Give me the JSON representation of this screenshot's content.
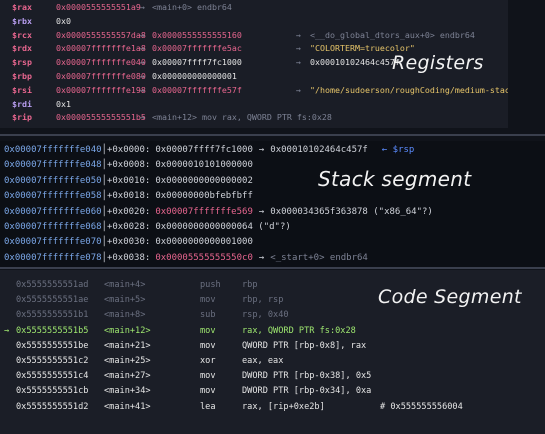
{
  "colors": {
    "reg_name": "#e8668f",
    "reg_name_alt": "#b89ef0",
    "pink": "#e8668f",
    "yellow": "#e8c66a",
    "value_white": "#e6e6e6",
    "grey": "#7d8294",
    "stack_addr": "#7ba7e8",
    "rsp_tag": "#5b8cff",
    "current_line": "#9fe870"
  },
  "registers": {
    "heading": "Registers",
    "rows": [
      {
        "name": "$rax",
        "v1": "0x0000555555551a9",
        "v2": "<main+0> endbr64",
        "v3": ""
      },
      {
        "name": "$rbx",
        "v1": "0x0",
        "v2": "",
        "v3": ""
      },
      {
        "name": "$rcx",
        "v1": "0x0000555555557da8",
        "v2": "0x0000555555555160",
        "v3": "<__do_global_dtors_aux+0> endbr64"
      },
      {
        "name": "$rdx",
        "v1": "0x00007fffffffe1a8",
        "v2": "0x00007fffffffe5ac",
        "v3": "\"COLORTERM=truecolor\""
      },
      {
        "name": "$rsp",
        "v1": "0x00007fffffffe040",
        "v2": "0x00007ffff7fc1000",
        "v3": "0x00010102464c457f"
      },
      {
        "name": "$rbp",
        "v1": "0x00007fffffffe080",
        "v2": "0x000000000000001",
        "v3": ""
      },
      {
        "name": "$rsi",
        "v1": "0x00007fffffffe198",
        "v2": "0x00007fffffffe57f",
        "v3": "\"/home/sudoerson/roughCoding/medium-stack/out\""
      },
      {
        "name": "$rdi",
        "v1": "0x1",
        "v2": "",
        "v3": ""
      },
      {
        "name": "$rip",
        "v1": "0x00005555555551b5",
        "v2": "<main+12> mov rax, QWORD PTR fs:0x28",
        "v3": ""
      }
    ]
  },
  "stack": {
    "heading": "Stack segment",
    "rows": [
      {
        "addr": "0x00007fffffffe040",
        "off": "+0x0000:",
        "val": "0x00007ffff7fc1000",
        "arrow": "→",
        "ext": "0x00010102464c457f",
        "tag": "← $rsp"
      },
      {
        "addr": "0x00007fffffffe048",
        "off": "+0x0008:",
        "val": "0x0000010101000000",
        "arrow": "",
        "ext": "",
        "tag": ""
      },
      {
        "addr": "0x00007fffffffe050",
        "off": "+0x0010:",
        "val": "0x0000000000000002",
        "arrow": "",
        "ext": "",
        "tag": ""
      },
      {
        "addr": "0x00007fffffffe058",
        "off": "+0x0018:",
        "val": "0x00000000bfebfbff",
        "arrow": "",
        "ext": "",
        "tag": ""
      },
      {
        "addr": "0x00007fffffffe060",
        "off": "+0x0020:",
        "val": "0x00007fffffffe569",
        "arrow": "→",
        "ext": "0x000034365f363878 (\"x86_64\"?)",
        "tag": ""
      },
      {
        "addr": "0x00007fffffffe068",
        "off": "+0x0028:",
        "val": "0x0000000000000064 (\"d\"?)",
        "arrow": "",
        "ext": "",
        "tag": ""
      },
      {
        "addr": "0x00007fffffffe070",
        "off": "+0x0030:",
        "val": "0x0000000000001000",
        "arrow": "",
        "ext": "",
        "tag": ""
      },
      {
        "addr": "0x00007fffffffe078",
        "off": "+0x0038:",
        "val": "0x00005555555550c0",
        "arrow": "→",
        "ext": "<_start+0> endbr64",
        "tag": ""
      }
    ]
  },
  "code": {
    "heading": "Code Segment",
    "rows": [
      {
        "marker": "",
        "addr": "0x5555555551ad",
        "sym": "<main+4>",
        "mn": "push",
        "op": "rbp",
        "cm": ""
      },
      {
        "marker": "",
        "addr": "0x5555555551ae",
        "sym": "<main+5>",
        "mn": "mov",
        "op": "rbp, rsp",
        "cm": ""
      },
      {
        "marker": "",
        "addr": "0x5555555551b1",
        "sym": "<main+8>",
        "mn": "sub",
        "op": "rsp, 0x40",
        "cm": ""
      },
      {
        "marker": "→",
        "addr": "0x5555555551b5",
        "sym": "<main+12>",
        "mn": "mov",
        "op": "rax, QWORD PTR fs:0x28",
        "cm": ""
      },
      {
        "marker": "",
        "addr": "0x5555555551be",
        "sym": "<main+21>",
        "mn": "mov",
        "op": "QWORD PTR [rbp-0x8], rax",
        "cm": ""
      },
      {
        "marker": "",
        "addr": "0x5555555551c2",
        "sym": "<main+25>",
        "mn": "xor",
        "op": "eax, eax",
        "cm": ""
      },
      {
        "marker": "",
        "addr": "0x5555555551c4",
        "sym": "<main+27>",
        "mn": "mov",
        "op": "DWORD PTR [rbp-0x38], 0x5",
        "cm": ""
      },
      {
        "marker": "",
        "addr": "0x5555555551cb",
        "sym": "<main+34>",
        "mn": "mov",
        "op": "DWORD PTR [rbp-0x34], 0xa",
        "cm": ""
      },
      {
        "marker": "",
        "addr": "0x5555555551d2",
        "sym": "<main+41>",
        "mn": "lea",
        "op": "rax, [rip+0xe2b]",
        "cm": "# 0x555555556004"
      }
    ]
  }
}
